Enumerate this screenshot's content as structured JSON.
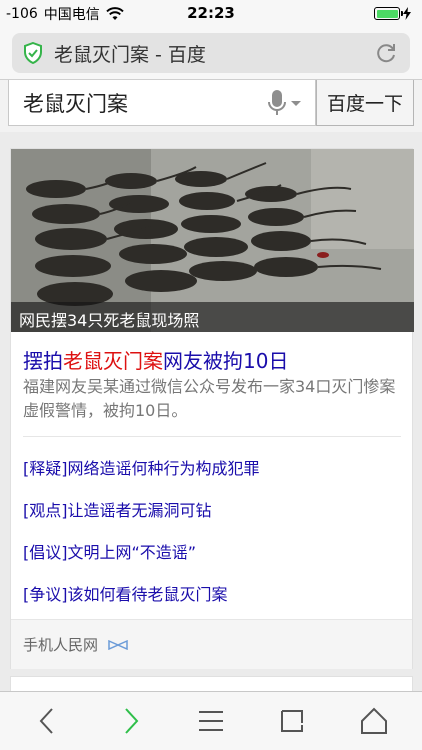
{
  "status_bar": {
    "signal": "-106",
    "carrier": "中国电信",
    "time": "22:23",
    "battery_percent": 100
  },
  "url_bar": {
    "title": "老鼠灭门案 - 百度",
    "secure_icon": "shield-check-icon",
    "reload_icon": "reload-icon"
  },
  "search": {
    "query": "老鼠灭门案",
    "button_label": "百度一下",
    "voice_icon": "microphone-icon"
  },
  "result": {
    "image_caption": "网民摆34只死老鼠现场照",
    "headline_pre": "摆拍",
    "headline_highlight": "老鼠灭门案",
    "headline_post": "网友被拘10日",
    "snippet": "福建网友吴某通过微信公众号发布一家34口灭门惨案虚假警情，被拘10日。",
    "related": [
      "[释疑]网络造谣何种行为构成犯罪",
      "[观点]让造谣者无漏洞可钻",
      "[倡议]文明上网“不造谣”",
      "[争议]该如何看待老鼠灭门案"
    ],
    "source": "手机人民网",
    "colors": {
      "link": "#1a0dab",
      "highlight": "#dd1111",
      "snippet": "#777777"
    }
  },
  "toolbar": {
    "items": [
      "back-icon",
      "forward-icon",
      "menu-icon",
      "tabs-icon",
      "home-icon"
    ]
  }
}
